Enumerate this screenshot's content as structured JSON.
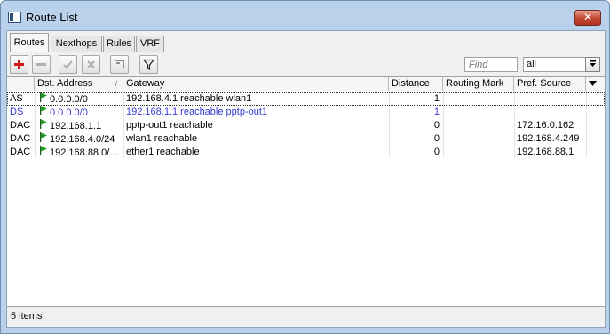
{
  "window": {
    "title": "Route List",
    "close_glyph": "✕"
  },
  "tabs": [
    {
      "label": "Routes",
      "active": true
    },
    {
      "label": "Nexthops",
      "active": false
    },
    {
      "label": "Rules",
      "active": false
    },
    {
      "label": "VRF",
      "active": false
    }
  ],
  "toolbar": {
    "buttons": [
      "add-icon",
      "remove-icon",
      "enable-icon",
      "disable-icon",
      "comment-icon",
      "filter-icon"
    ],
    "find_placeholder": "Find",
    "filter_value": "all"
  },
  "columns": [
    "",
    "Dst. Address",
    "Gateway",
    "Distance",
    "Routing Mark",
    "Pref. Source"
  ],
  "sort_indicator": "/",
  "rows": [
    {
      "flags": "AS",
      "dst": "0.0.0.0/0",
      "gateway": "192.168.4.1 reachable wlan1",
      "distance": "1",
      "routing_mark": "",
      "pref_source": "",
      "color": "#000000",
      "selected": true
    },
    {
      "flags": "DS",
      "dst": "0.0.0.0/0",
      "gateway": "192.168.1.1 reachable pptp-out1",
      "distance": "1",
      "routing_mark": "",
      "pref_source": "",
      "color": "#3a3ad0",
      "selected": false
    },
    {
      "flags": "DAC",
      "dst": "192.168.1.1",
      "gateway": "pptp-out1 reachable",
      "distance": "0",
      "routing_mark": "",
      "pref_source": "172.16.0.162",
      "color": "#000000",
      "selected": false
    },
    {
      "flags": "DAC",
      "dst": "192.168.4.0/24",
      "gateway": "wlan1 reachable",
      "distance": "0",
      "routing_mark": "",
      "pref_source": "192.168.4.249",
      "color": "#000000",
      "selected": false
    },
    {
      "flags": "DAC",
      "dst": "192.168.88.0/...",
      "gateway": "ether1 reachable",
      "distance": "0",
      "routing_mark": "",
      "pref_source": "192.168.88.1",
      "color": "#000000",
      "selected": false
    }
  ],
  "status": "5 items",
  "colors": {
    "active_flag": "#1a9a1a",
    "dynamic_text": "#3a3ad0",
    "title_bg": "#b9d1ea",
    "close_button": "#c64b33"
  }
}
